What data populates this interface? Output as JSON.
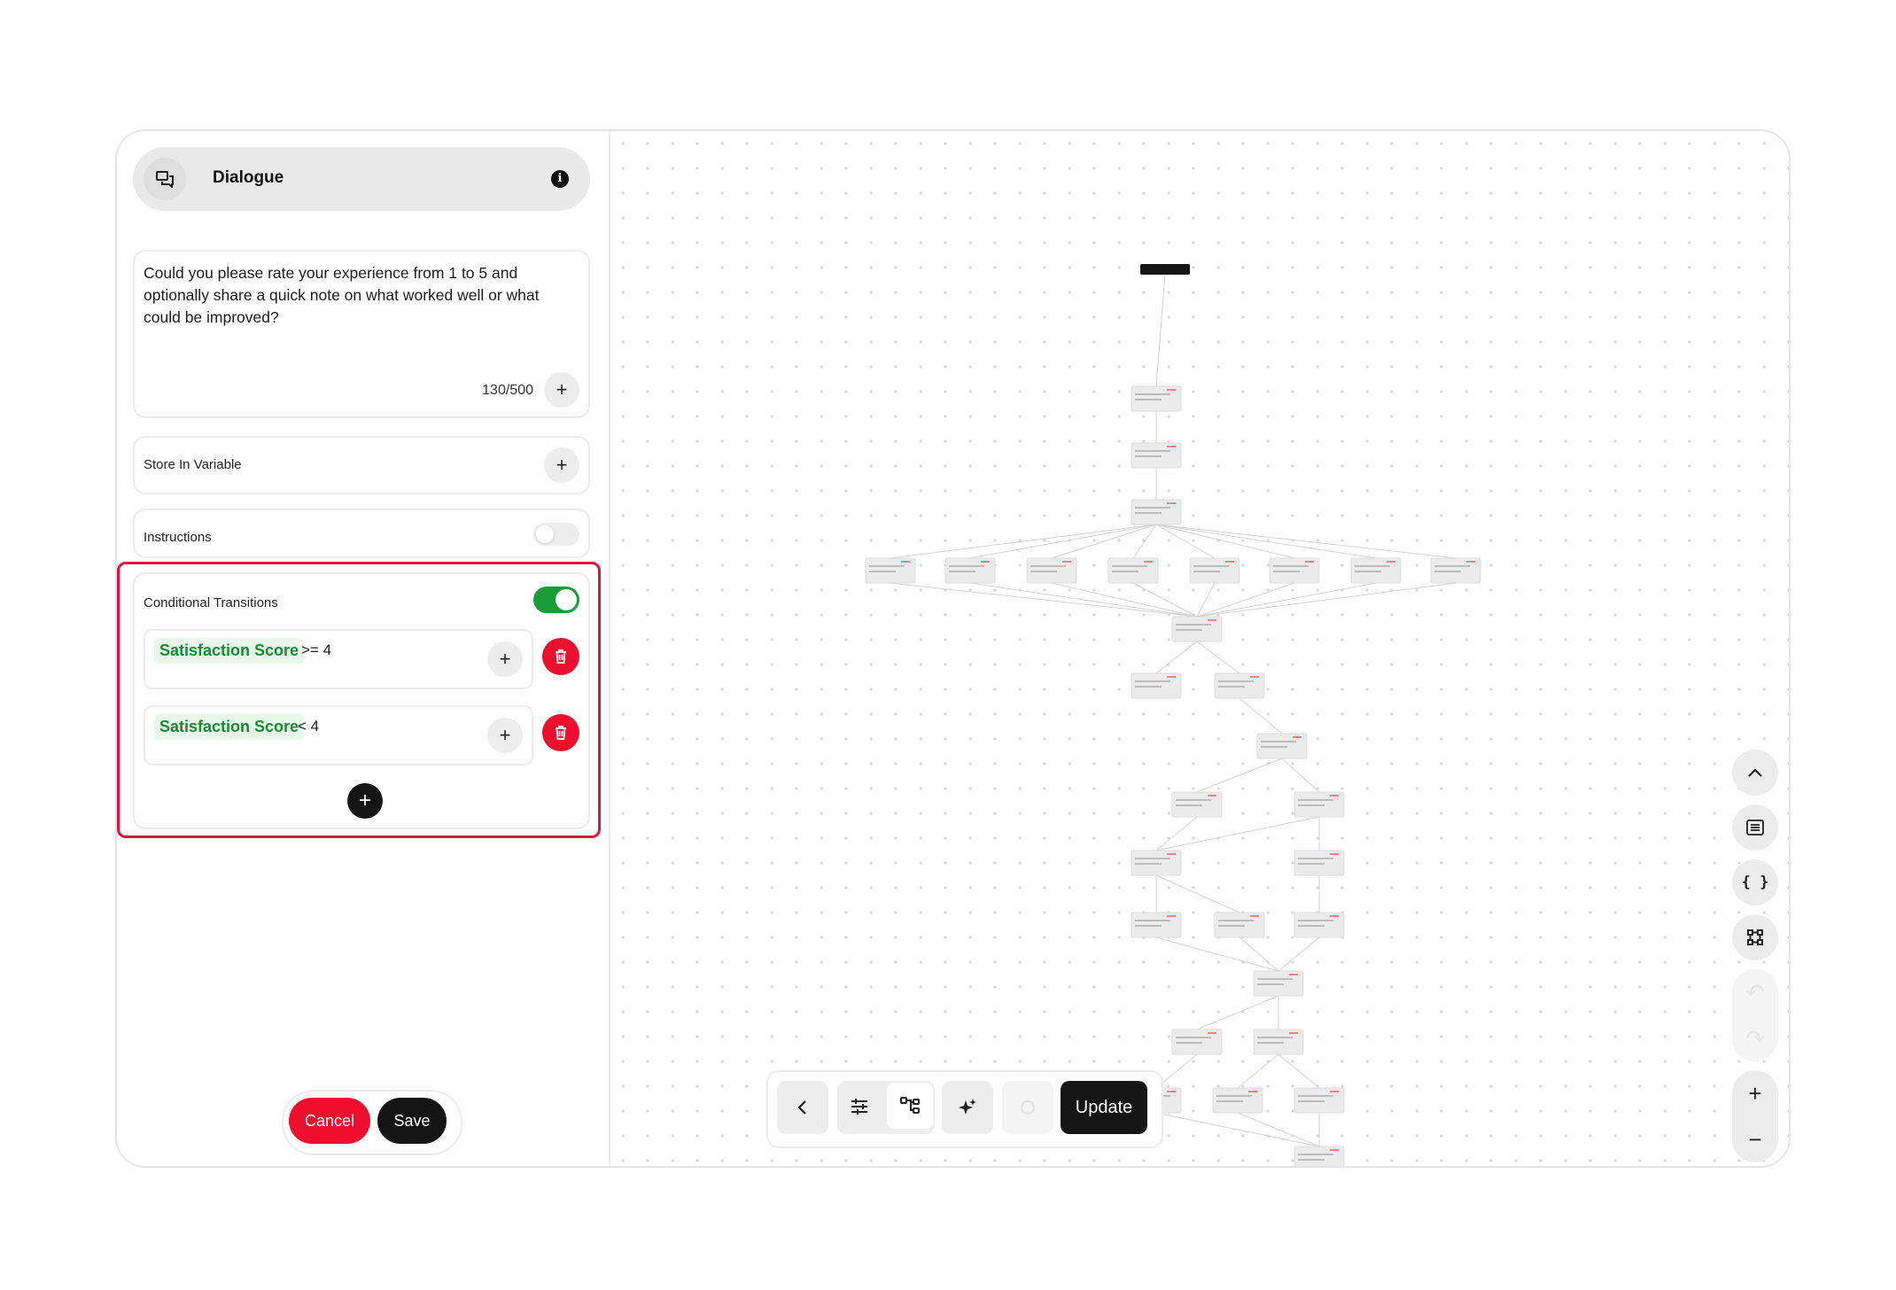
{
  "header": {
    "title": "Dialogue",
    "info_icon": "info-icon",
    "node_icon": "chat-bubbles-icon"
  },
  "prompt": {
    "text": "Could you please rate your experience from 1 to 5 and optionally share a quick note on what worked well or what could be improved?",
    "count": "130/500"
  },
  "store_variable": {
    "label": "Store In Variable"
  },
  "instructions": {
    "label": "Instructions",
    "enabled": false
  },
  "conditional": {
    "label": "Conditional Transitions",
    "enabled": true,
    "rules": [
      {
        "variable": "Satisfaction Score",
        "operator": ">= 4"
      },
      {
        "variable": "Satisfaction Score",
        "operator": "< 4"
      }
    ]
  },
  "footer": {
    "cancel": "Cancel",
    "save": "Save"
  },
  "toolbar": {
    "update": "Update"
  },
  "colors": {
    "accent_red": "#ee0f2f",
    "toggle_green": "#1a9b3a",
    "chip_green": "#1a8a34",
    "dark": "#151515"
  }
}
